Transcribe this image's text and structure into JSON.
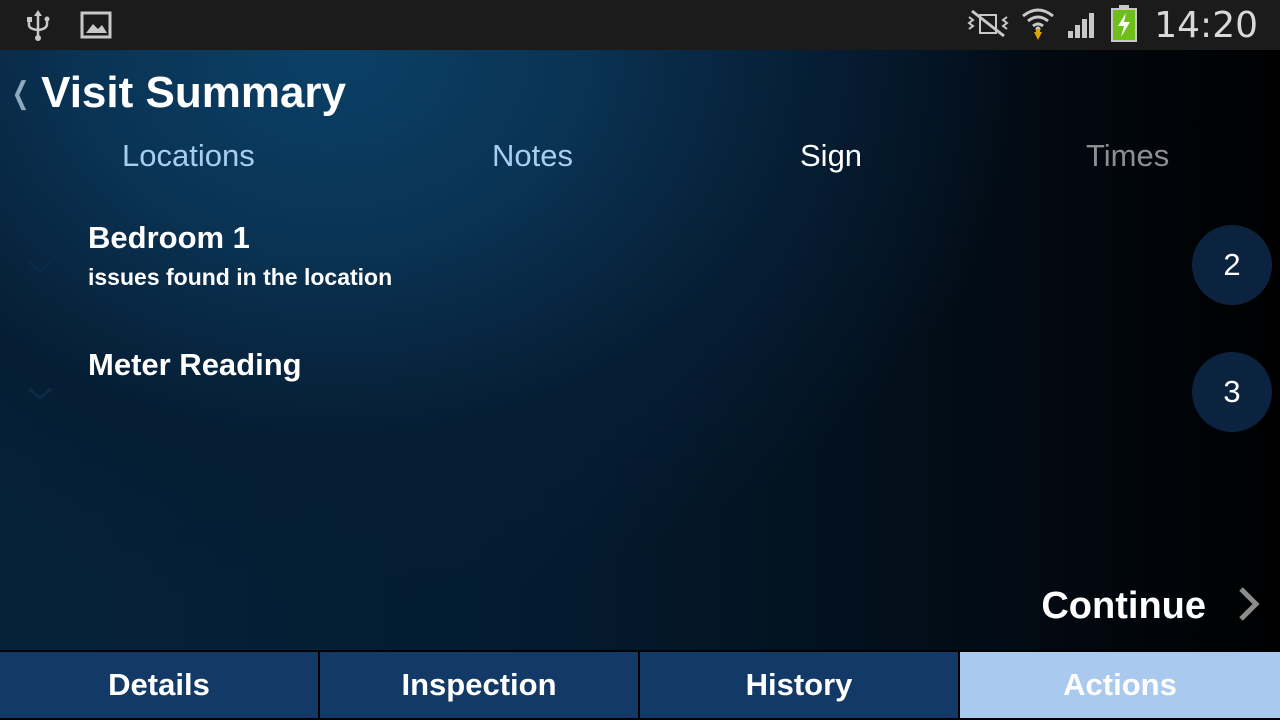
{
  "status_bar": {
    "left_icons": [
      "usb-icon",
      "image-notification-icon"
    ],
    "right_icons": [
      "mute-vibrate-icon",
      "wifi-icon",
      "signal-icon",
      "battery-charging-icon"
    ],
    "time": "14:20"
  },
  "header": {
    "back_icon": "chevron-left-icon",
    "title": "Visit Summary"
  },
  "tabs": [
    {
      "label": "Locations",
      "state": "inactive"
    },
    {
      "label": "Notes",
      "state": "inactive"
    },
    {
      "label": "Sign",
      "state": "selected"
    },
    {
      "label": "Times",
      "state": "disabled"
    }
  ],
  "locations": [
    {
      "title": "Bedroom 1",
      "subtitle": "issues found in the location",
      "count": "2",
      "icon": "chevron-down-icon"
    },
    {
      "title": "Meter Reading",
      "subtitle": "",
      "count": "3",
      "icon": "chevron-down-icon"
    }
  ],
  "continue": {
    "label": "Continue",
    "icon": "chevron-right-icon"
  },
  "bottom_nav": [
    {
      "label": "Details",
      "active": false
    },
    {
      "label": "Inspection",
      "active": false
    },
    {
      "label": "History",
      "active": false
    },
    {
      "label": "Actions",
      "active": true
    }
  ],
  "colors": {
    "accent_active_tab": "#a9c9ee",
    "nav_background": "#133a66",
    "badge_background": "#0c2340",
    "tab_text": "#a8cdf0"
  }
}
